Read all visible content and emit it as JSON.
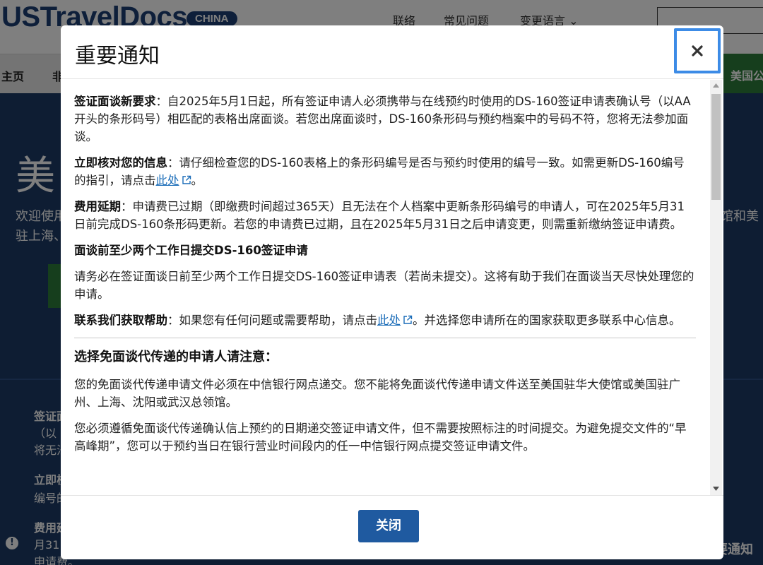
{
  "site": {
    "logo": "USTravelDocs",
    "country_badge": "CHINA",
    "top_links": [
      "联络",
      "常见问题",
      "变更语言 ⌄"
    ],
    "nav": [
      "主页",
      "非",
      "美国公"
    ],
    "hero_title": "美",
    "hero_text_1": "欢迎使用",
    "hero_text_2": "驻上海、",
    "hero_text_right": "馆和美",
    "notice_lines": [
      {
        "text": "签证面",
        "bold": true
      },
      {
        "text": "（以",
        "bold": false
      },
      {
        "text": "将无法",
        "bold": false
      },
      {
        "text": "立即核",
        "bold": true
      },
      {
        "text": "编号的",
        "bold": false
      },
      {
        "text": "费用延",
        "bold": true
      },
      {
        "text": "月31",
        "bold": false
      },
      {
        "text": "申请费。",
        "bold": false
      }
    ],
    "notice_tag": "要通知"
  },
  "modal": {
    "title": "重要通知",
    "close_icon": "close-icon",
    "p1_title": "签证面谈新要求",
    "p1_text": "：自2025年5月1日起，所有签证申请人必须携带与在线预约时使用的DS-160签证申请表确认号（以AA开头的条形码号）相匹配的表格出席面谈。若您出席面谈时，DS-160条形码与预约档案中的号码不符，您将无法参加面谈。",
    "p2_title": "立即核对您的信息",
    "p2_text_a": "：请仔细检查您的DS-160表格上的条形码编号是否与预约时使用的编号一致。如需更新DS-160编号的指引，请点击",
    "p2_link": "此处",
    "p2_text_b": "。",
    "p3_title": "费用延期",
    "p3_text": "：申请费已过期（即缴费时间超过365天）且无法在个人档案中更新条形码编号的申请人，可在2025年5月31日前完成DS-160条形码更新。若您的申请费已过期，且在2025年5月31日之后申请变更，则需重新缴纳签证申请费。",
    "p4_heading": "面谈前至少两个工作日提交DS-160签证申请",
    "p4_text": "请务必在签证面谈日前至少两个工作日提交DS-160签证申请表（若尚未提交）。这将有助于我们在面谈当天尽快处理您的申请。",
    "p5_title": "联系我们获取帮助",
    "p5_text_a": "：如果您有任何问题或需要帮助，请点击",
    "p5_link": "此处",
    "p5_text_b": "。并选择您申请所在的国家获取更多联系中心信息。",
    "section2_heading": "选择免面谈代传递的申请人请注意：",
    "s2_p1": "您的免面谈代传递申请文件必须在中信银行网点递交。您不能将免面谈代传递申请文件送至美国驻华大使馆或美国驻广州、上海、沈阳或武汉总领馆。",
    "s2_p2": "您必须遵循免面谈代传递确认信上预约的日期递交签证申请文件，但不需要按照标注的时间提交。为避免提交文件的“早高峰期”，您可以于预约当日在银行营业时间段内的任一中信银行网点提交签证申请文件。",
    "footer_button": "关闭"
  },
  "colors": {
    "brand_navy": "#1c3f74",
    "hero_bg": "#1d3b66",
    "nav_green": "#2d7d3a",
    "link": "#1a6cb8",
    "button": "#1f5aa0",
    "focus_ring": "#3c8be6"
  }
}
